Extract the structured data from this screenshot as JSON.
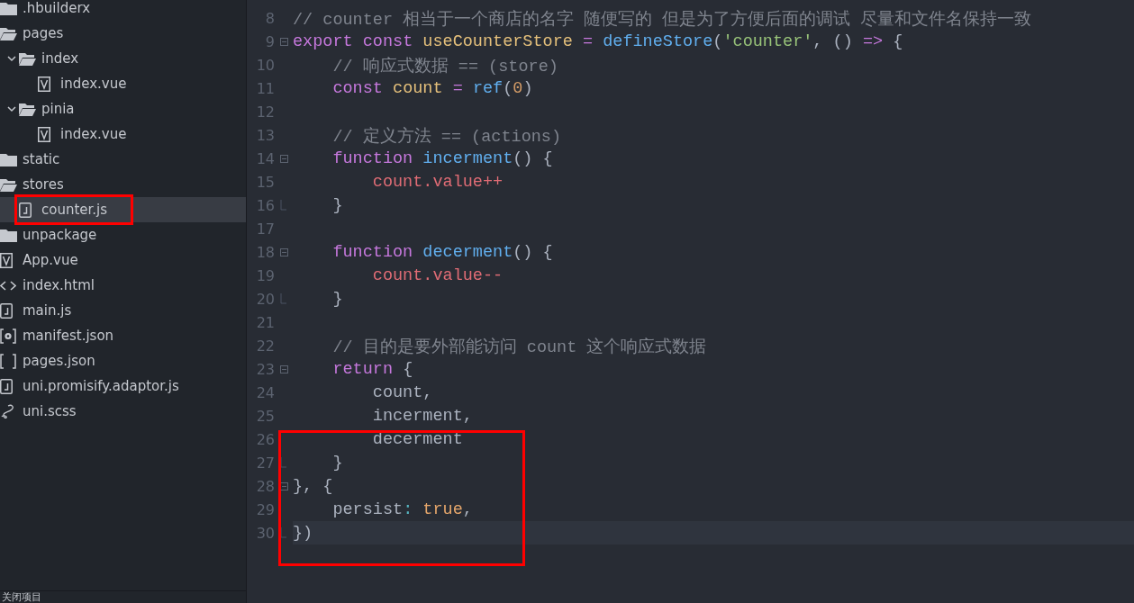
{
  "sidebar": {
    "items": [
      {
        "kind": "folder",
        "label": ".hbuilderx",
        "expanded": false,
        "selected": false
      },
      {
        "kind": "folder",
        "label": "pages",
        "expanded": true,
        "selected": false,
        "children": [
          {
            "kind": "folder",
            "label": "index",
            "expanded": true,
            "selected": false,
            "children": [
              {
                "kind": "vue",
                "label": "index.vue",
                "selected": false
              }
            ]
          },
          {
            "kind": "folder",
            "label": "pinia",
            "expanded": true,
            "selected": false,
            "children": [
              {
                "kind": "vue",
                "label": "index.vue",
                "selected": false
              }
            ]
          }
        ]
      },
      {
        "kind": "folder",
        "label": "static",
        "expanded": false,
        "selected": false
      },
      {
        "kind": "folder",
        "label": "stores",
        "expanded": true,
        "selected": false,
        "children": [
          {
            "kind": "js",
            "label": "counter.js",
            "selected": true,
            "annotated": true
          }
        ]
      },
      {
        "kind": "folder",
        "label": "unpackage",
        "expanded": false,
        "selected": false
      },
      {
        "kind": "vue",
        "label": "App.vue",
        "selected": false
      },
      {
        "kind": "html",
        "label": "index.html",
        "selected": false
      },
      {
        "kind": "js",
        "label": "main.js",
        "selected": false
      },
      {
        "kind": "manifest",
        "label": "manifest.json",
        "selected": false
      },
      {
        "kind": "json",
        "label": "pages.json",
        "selected": false
      },
      {
        "kind": "js",
        "label": "uni.promisify.adaptor.js",
        "selected": false
      },
      {
        "kind": "scss",
        "label": "uni.scss",
        "selected": false
      }
    ],
    "footer": "关闭项目"
  },
  "editor": {
    "lines": [
      {
        "number": "8",
        "tokens": [
          {
            "kind": "comment",
            "text": "// counter 相当于一个商店的名字 随便写的 但是为了方便后面的调试 尽量和文件名保持一致"
          }
        ]
      },
      {
        "number": "9",
        "foldable": true,
        "tokens": [
          {
            "kind": "keyword",
            "text": "export "
          },
          {
            "kind": "keyword",
            "text": "const "
          },
          {
            "kind": "variable",
            "text": "useCounterStore "
          },
          {
            "kind": "operator",
            "text": "= "
          },
          {
            "kind": "function",
            "text": "defineStore"
          },
          {
            "kind": "plain",
            "text": "("
          },
          {
            "kind": "string",
            "text": "'counter'"
          },
          {
            "kind": "plain",
            "text": ", () "
          },
          {
            "kind": "operator",
            "text": "=>"
          },
          {
            "kind": "plain",
            "text": " {"
          }
        ]
      },
      {
        "number": "10",
        "tokens": [
          {
            "kind": "comment",
            "text": "    // 响应式数据 == (store)"
          }
        ]
      },
      {
        "number": "11",
        "tokens": [
          {
            "kind": "keyword",
            "text": "    const "
          },
          {
            "kind": "variable",
            "text": "count "
          },
          {
            "kind": "operator",
            "text": "= "
          },
          {
            "kind": "function",
            "text": "ref"
          },
          {
            "kind": "plain",
            "text": "("
          },
          {
            "kind": "number",
            "text": "0"
          },
          {
            "kind": "plain",
            "text": ")"
          }
        ]
      },
      {
        "number": "12"
      },
      {
        "number": "13",
        "tokens": [
          {
            "kind": "comment",
            "text": "    // 定义方法 == (actions)"
          }
        ]
      },
      {
        "number": "14",
        "foldable": true,
        "tokens": [
          {
            "kind": "keyword",
            "text": "    function "
          },
          {
            "kind": "function",
            "text": "incerment"
          },
          {
            "kind": "plain",
            "text": "() {"
          }
        ]
      },
      {
        "number": "15",
        "tokens": [
          {
            "kind": "member",
            "text": "        count.value++"
          }
        ]
      },
      {
        "number": "16",
        "fold_end": true,
        "tokens": [
          {
            "kind": "plain",
            "text": "    }"
          }
        ]
      },
      {
        "number": "17"
      },
      {
        "number": "18",
        "foldable": true,
        "tokens": [
          {
            "kind": "keyword",
            "text": "    function "
          },
          {
            "kind": "function",
            "text": "decerment"
          },
          {
            "kind": "plain",
            "text": "() {"
          }
        ]
      },
      {
        "number": "19",
        "tokens": [
          {
            "kind": "member",
            "text": "        count.value--"
          }
        ]
      },
      {
        "number": "20",
        "fold_end": true,
        "tokens": [
          {
            "kind": "plain",
            "text": "    }"
          }
        ]
      },
      {
        "number": "21"
      },
      {
        "number": "22",
        "tokens": [
          {
            "kind": "comment",
            "text": "    // 目的是要外部能访问 count 这个响应式数据"
          }
        ]
      },
      {
        "number": "23",
        "foldable": true,
        "tokens": [
          {
            "kind": "keyword",
            "text": "    return"
          },
          {
            "kind": "plain",
            "text": " {"
          }
        ]
      },
      {
        "number": "24",
        "tokens": [
          {
            "kind": "plain",
            "text": "        count,"
          }
        ]
      },
      {
        "number": "25",
        "tokens": [
          {
            "kind": "plain",
            "text": "        incerment,"
          }
        ]
      },
      {
        "number": "26",
        "annotated": true,
        "tokens": [
          {
            "kind": "plain",
            "text": "        decerment"
          }
        ]
      },
      {
        "number": "27",
        "fold_end": true,
        "annotated": true,
        "tokens": [
          {
            "kind": "plain",
            "text": "    }"
          }
        ]
      },
      {
        "number": "28",
        "foldable": true,
        "annotated": true,
        "tokens": [
          {
            "kind": "plain",
            "text": "}, {"
          }
        ]
      },
      {
        "number": "29",
        "annotated": true,
        "tokens": [
          {
            "kind": "plain",
            "text": "    persist"
          },
          {
            "kind": "punct",
            "text": ":"
          },
          {
            "kind": "constant",
            "text": " true"
          },
          {
            "kind": "plain",
            "text": ","
          }
        ]
      },
      {
        "number": "30",
        "fold_end": true,
        "annotated": true,
        "current": true,
        "tokens": [
          {
            "kind": "plain",
            "text": "})"
          }
        ]
      }
    ]
  }
}
